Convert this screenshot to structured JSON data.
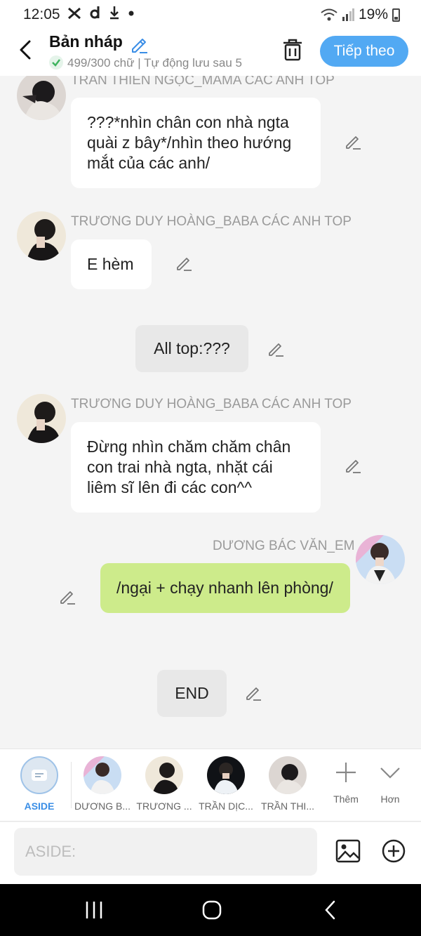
{
  "status_bar": {
    "time": "12:05",
    "icons": [
      "status-app-icon",
      "status-d-icon",
      "download-icon",
      "dot-icon"
    ],
    "battery": "19%"
  },
  "header": {
    "title": "Bản nháp",
    "subtitle": "499/300 chữ | Tự động lưu sau 5",
    "next_label": "Tiếp theo"
  },
  "messages": [
    {
      "speaker": "TRAN THIEN NGỌC_MAMA CÁC ANH TOP",
      "text": "???*nhìn chân con nhà ngta quài z bây*/nhìn theo hướng mắt của các anh/",
      "side": "left"
    },
    {
      "speaker": "TRƯƠNG DUY HOÀNG_BABA CÁC ANH TOP",
      "text": "E hèm",
      "side": "left"
    },
    {
      "speaker": "",
      "text": "All top:???",
      "side": "center"
    },
    {
      "speaker": "TRƯƠNG DUY HOÀNG_BABA CÁC ANH TOP",
      "text": "Đừng nhìn chăm chăm chân con trai nhà ngta, nhặt cái liêm sĩ lên đi các con^^",
      "side": "left"
    },
    {
      "speaker": "DƯƠNG BÁC VĂN_EM",
      "text": "/ngại + chạy nhanh lên phòng/",
      "side": "right"
    },
    {
      "speaker": "",
      "text": "END",
      "side": "center"
    }
  ],
  "characters": [
    {
      "label": "ASIDE",
      "active": true
    },
    {
      "label": "DƯƠNG B..."
    },
    {
      "label": "TRƯƠNG ..."
    },
    {
      "label": "TRẦN DỊC..."
    },
    {
      "label": "TRẦN THI..."
    }
  ],
  "tools": {
    "add_label": "Thêm",
    "more_label": "Hơn"
  },
  "composer": {
    "placeholder": "ASIDE:"
  },
  "colors": {
    "accent": "#52a9f3",
    "mine_bubble": "#cdeb8b",
    "background": "#f4f4f4"
  }
}
